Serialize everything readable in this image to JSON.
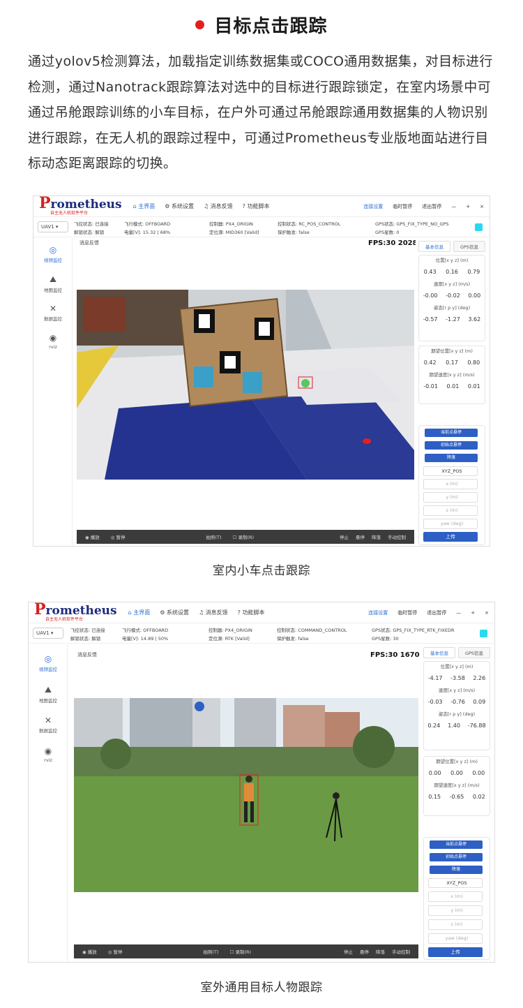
{
  "section": {
    "title": "目标点击跟踪"
  },
  "paragraph": "通过yolov5检测算法，加载指定训练数据集或COCO通用数据集，对目标进行检测，通过Nanotrack跟踪算法对选中的目标进行跟踪锁定，在室内场景中可通过吊舱跟踪训练的小车目标，在户外可通过吊舱跟踪通用数据集的人物识别进行跟踪，在无人机的跟踪过程中，可通过Prometheus专业版地面站进行目标动态距离跟踪的切换。",
  "common": {
    "logo": "rometheus",
    "logo_p": "P",
    "logo_sub": "自主无人机软件平台",
    "nav": [
      "主界面",
      "系统设置",
      "消息反馈",
      "功能脚本"
    ],
    "top_right": [
      "连接设置",
      "临时暂停",
      "退出暂停",
      "—",
      "+",
      "×"
    ],
    "uav_select": "UAV1 ▾",
    "sidebar": [
      "视频监控",
      "地图监控",
      "数据监控",
      "rviz"
    ],
    "sidebar_icons": [
      "◎",
      "⛰",
      "✕",
      "◉"
    ],
    "video_head": "消息反馈",
    "tabs": [
      "基本信息",
      "GPS信息"
    ],
    "pos_label": "位置[x y z] (m)",
    "vel_label": "速度[x y z] (m/s)",
    "att_label": "姿态[r p y] (deg)",
    "exp_pos_label": "期望位置[x y z] (m)",
    "exp_vel_label": "期望速度[x y z] (m/s)",
    "buttons": [
      "当前点悬停",
      "初始点悬停",
      "降落"
    ],
    "select": "XYZ_POS",
    "fields": [
      "x (m)",
      "y (m)",
      "z (m)",
      "yaw (deg)"
    ],
    "upload": "上传",
    "ctrl_left": [
      "◉ 播放",
      "◎ 暂停"
    ],
    "ctrl_mid": [
      "拍照(T)",
      "☐ 录制(R)"
    ],
    "ctrl_right": [
      "停止",
      "悬停",
      "降落",
      "手动控制"
    ]
  },
  "shot1": {
    "status_line1": [
      "飞控状态: 已连接",
      "飞行模式: OFFBOARD",
      "控制器: PX4_ORIGIN",
      "控制状态: RC_POS_CONTROL",
      "GPS状态: GPS_FIX_TYPE_NO_GPS"
    ],
    "status_line2": [
      "解锁状态: 解锁",
      "电量[V]: 15.32 | 68%",
      "定位源: MID360 [Valid]",
      "保护触发: false",
      "GPS星数: 0"
    ],
    "fps": "FPS:30  2028",
    "pos": [
      "0.43",
      "0.16",
      "0.79"
    ],
    "vel": [
      "-0.00",
      "-0.02",
      "0.00"
    ],
    "att": [
      "-0.57",
      "-1.27",
      "3.62"
    ],
    "exp_pos": [
      "0.42",
      "0.17",
      "0.80"
    ],
    "exp_vel": [
      "-0.01",
      "0.01",
      "0.01"
    ],
    "caption": "室内小车点击跟踪"
  },
  "shot2": {
    "status_line1": [
      "飞控状态: 已连接",
      "飞行模式: OFFBOARD",
      "控制器: PX4_ORIGIN",
      "控制状态: COMMAND_CONTROL",
      "GPS状态: GPS_FIX_TYPE_RTK_FIXEDR"
    ],
    "status_line2": [
      "解锁状态: 解锁",
      "电量[V]: 14.89 | 50%",
      "定位源: RTK [Valid]",
      "保护触发: false",
      "GPS星数: 30"
    ],
    "fps": "FPS:30  1670",
    "pos": [
      "-4.17",
      "-3.58",
      "2.26"
    ],
    "vel": [
      "-0.03",
      "-0.76",
      "0.09"
    ],
    "att": [
      "0.24",
      "1.40",
      "-76.88"
    ],
    "exp_pos": [
      "0.00",
      "0.00",
      "0.00"
    ],
    "exp_vel": [
      "0.15",
      "-0.65",
      "0.02"
    ],
    "caption": "室外通用目标人物跟踪"
  },
  "colors": {
    "accent": "#2d5fc4",
    "red": "#e02020",
    "gps_badge": "#29d9f0"
  }
}
